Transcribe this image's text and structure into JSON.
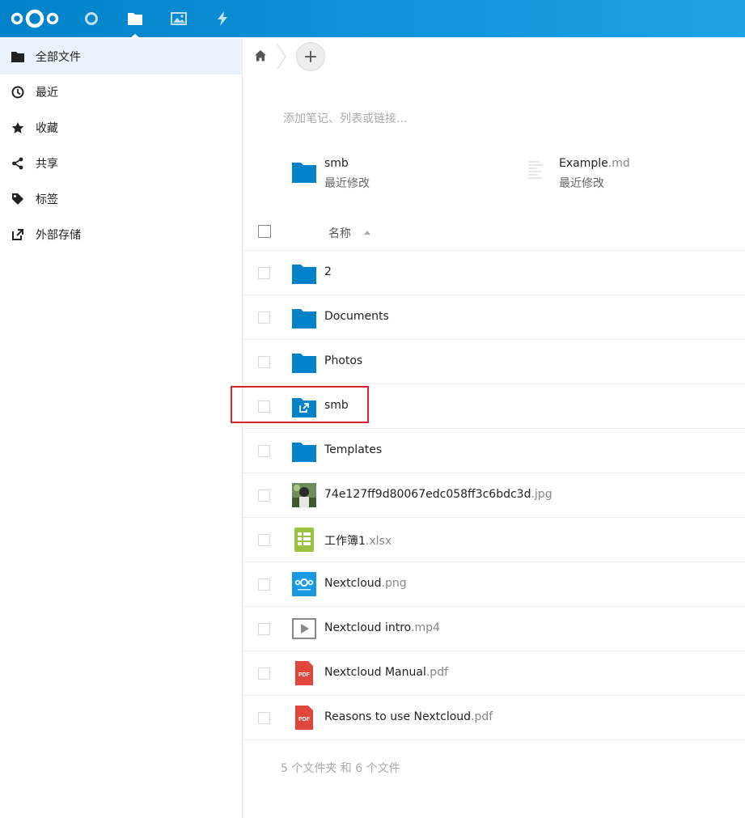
{
  "header": {
    "apps": [
      {
        "name": "dashboard",
        "icon": "circle-icon"
      },
      {
        "name": "files",
        "icon": "folder-icon",
        "active": true
      },
      {
        "name": "photos",
        "icon": "image-icon"
      },
      {
        "name": "activity",
        "icon": "lightning-icon"
      }
    ]
  },
  "sidebar": {
    "items": [
      {
        "label": "全部文件",
        "icon": "folder-icon"
      },
      {
        "label": "最近",
        "icon": "clock-icon"
      },
      {
        "label": "收藏",
        "icon": "star-icon"
      },
      {
        "label": "共享",
        "icon": "share-icon"
      },
      {
        "label": "标签",
        "icon": "tag-icon"
      },
      {
        "label": "外部存储",
        "icon": "external-link-icon"
      }
    ]
  },
  "main": {
    "add_label": "+",
    "notes_placeholder": "添加笔记、列表或链接...",
    "recent": [
      {
        "name": "smb",
        "ext": "",
        "sub": "最近修改"
      },
      {
        "name": "Example",
        "ext": ".md",
        "sub": "最近修改"
      }
    ],
    "column_name": "名称",
    "files": [
      {
        "name": "2",
        "ext": "",
        "type": "folder"
      },
      {
        "name": "Documents",
        "ext": "",
        "type": "folder"
      },
      {
        "name": "Photos",
        "ext": "",
        "type": "folder"
      },
      {
        "name": "smb",
        "ext": "",
        "type": "external-folder"
      },
      {
        "name": "Templates",
        "ext": "",
        "type": "folder"
      },
      {
        "name": "74e127ff9d80067edc058ff3c6bdc3d",
        "ext": ".jpg",
        "type": "image"
      },
      {
        "name": "工作簿1",
        "ext": ".xlsx",
        "type": "spreadsheet"
      },
      {
        "name": "Nextcloud",
        "ext": ".png",
        "type": "png"
      },
      {
        "name": "Nextcloud intro",
        "ext": ".mp4",
        "type": "video"
      },
      {
        "name": "Nextcloud Manual",
        "ext": ".pdf",
        "type": "pdf"
      },
      {
        "name": "Reasons to use Nextcloud",
        "ext": ".pdf",
        "type": "pdf"
      }
    ],
    "summary": "5 个文件夹 和 6 个文件",
    "colors": {
      "accent": "#0082c9",
      "folder": "#0082c9",
      "pdf": "#e2453c",
      "sheet": "#9bc141"
    }
  }
}
